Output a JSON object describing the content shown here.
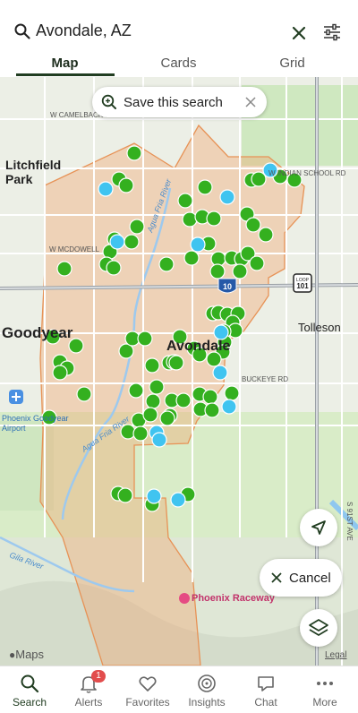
{
  "search": {
    "query": "Avondale, AZ"
  },
  "tabs": [
    {
      "label": "Map",
      "active": true
    },
    {
      "label": "Cards",
      "active": false
    },
    {
      "label": "Grid",
      "active": false
    }
  ],
  "map": {
    "save_search_label": "Save this search",
    "cancel_label": "Cancel",
    "attribution": "Maps",
    "legal": "Legal",
    "place_labels": {
      "litchfield_park": "Litchfield\nPark",
      "goodyear": "Goodyear",
      "avondale": "Avondale",
      "tolleson": "Tolleson",
      "phoenix_raceway": "Phoenix Raceway",
      "airport": "Phoenix Goodyear\nAirport"
    },
    "road_labels": {
      "camelback": "W CAMELBACK RD",
      "indian_school": "W INDIAN SCHOOL RD",
      "mcdowell": "W MCDOWELL",
      "buckeye": "BUCKEYE RD",
      "agua_fria_north": "Agua Fria River",
      "agua_fria_south": "Agua Fria River",
      "gila": "Gila River",
      "i10": "10",
      "loop101": "101",
      "loop_tag": "LOOP",
      "ave_91": "S 91ST AVE"
    },
    "colors": {
      "listing_green": "#34b01f",
      "listing_blue": "#40c4f0",
      "boundary": "#f1a36d"
    }
  },
  "nav": [
    {
      "label": "Search",
      "icon": "search-icon",
      "active": true
    },
    {
      "label": "Alerts",
      "icon": "bell-icon",
      "badge": "1"
    },
    {
      "label": "Favorites",
      "icon": "heart-icon"
    },
    {
      "label": "Insights",
      "icon": "insights-icon"
    },
    {
      "label": "Chat",
      "icon": "chat-icon"
    },
    {
      "label": "More",
      "icon": "more-icon"
    }
  ]
}
